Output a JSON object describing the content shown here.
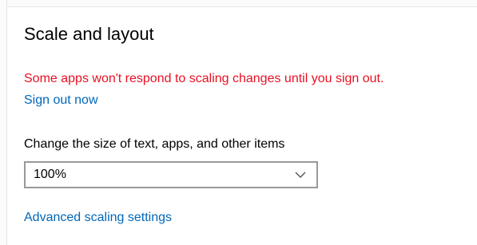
{
  "section": {
    "title": "Scale and layout"
  },
  "warning": {
    "text": "Some apps won't respond to scaling changes until you sign out."
  },
  "links": {
    "sign_out": "Sign out now",
    "advanced": "Advanced scaling settings"
  },
  "scale": {
    "label": "Change the size of text, apps, and other items",
    "selected": "100%"
  },
  "icons": {
    "dropdown": "chevron-down-icon"
  },
  "colors": {
    "warning": "#e81123",
    "link": "#0067b8",
    "dropdown_border": "#999999"
  }
}
